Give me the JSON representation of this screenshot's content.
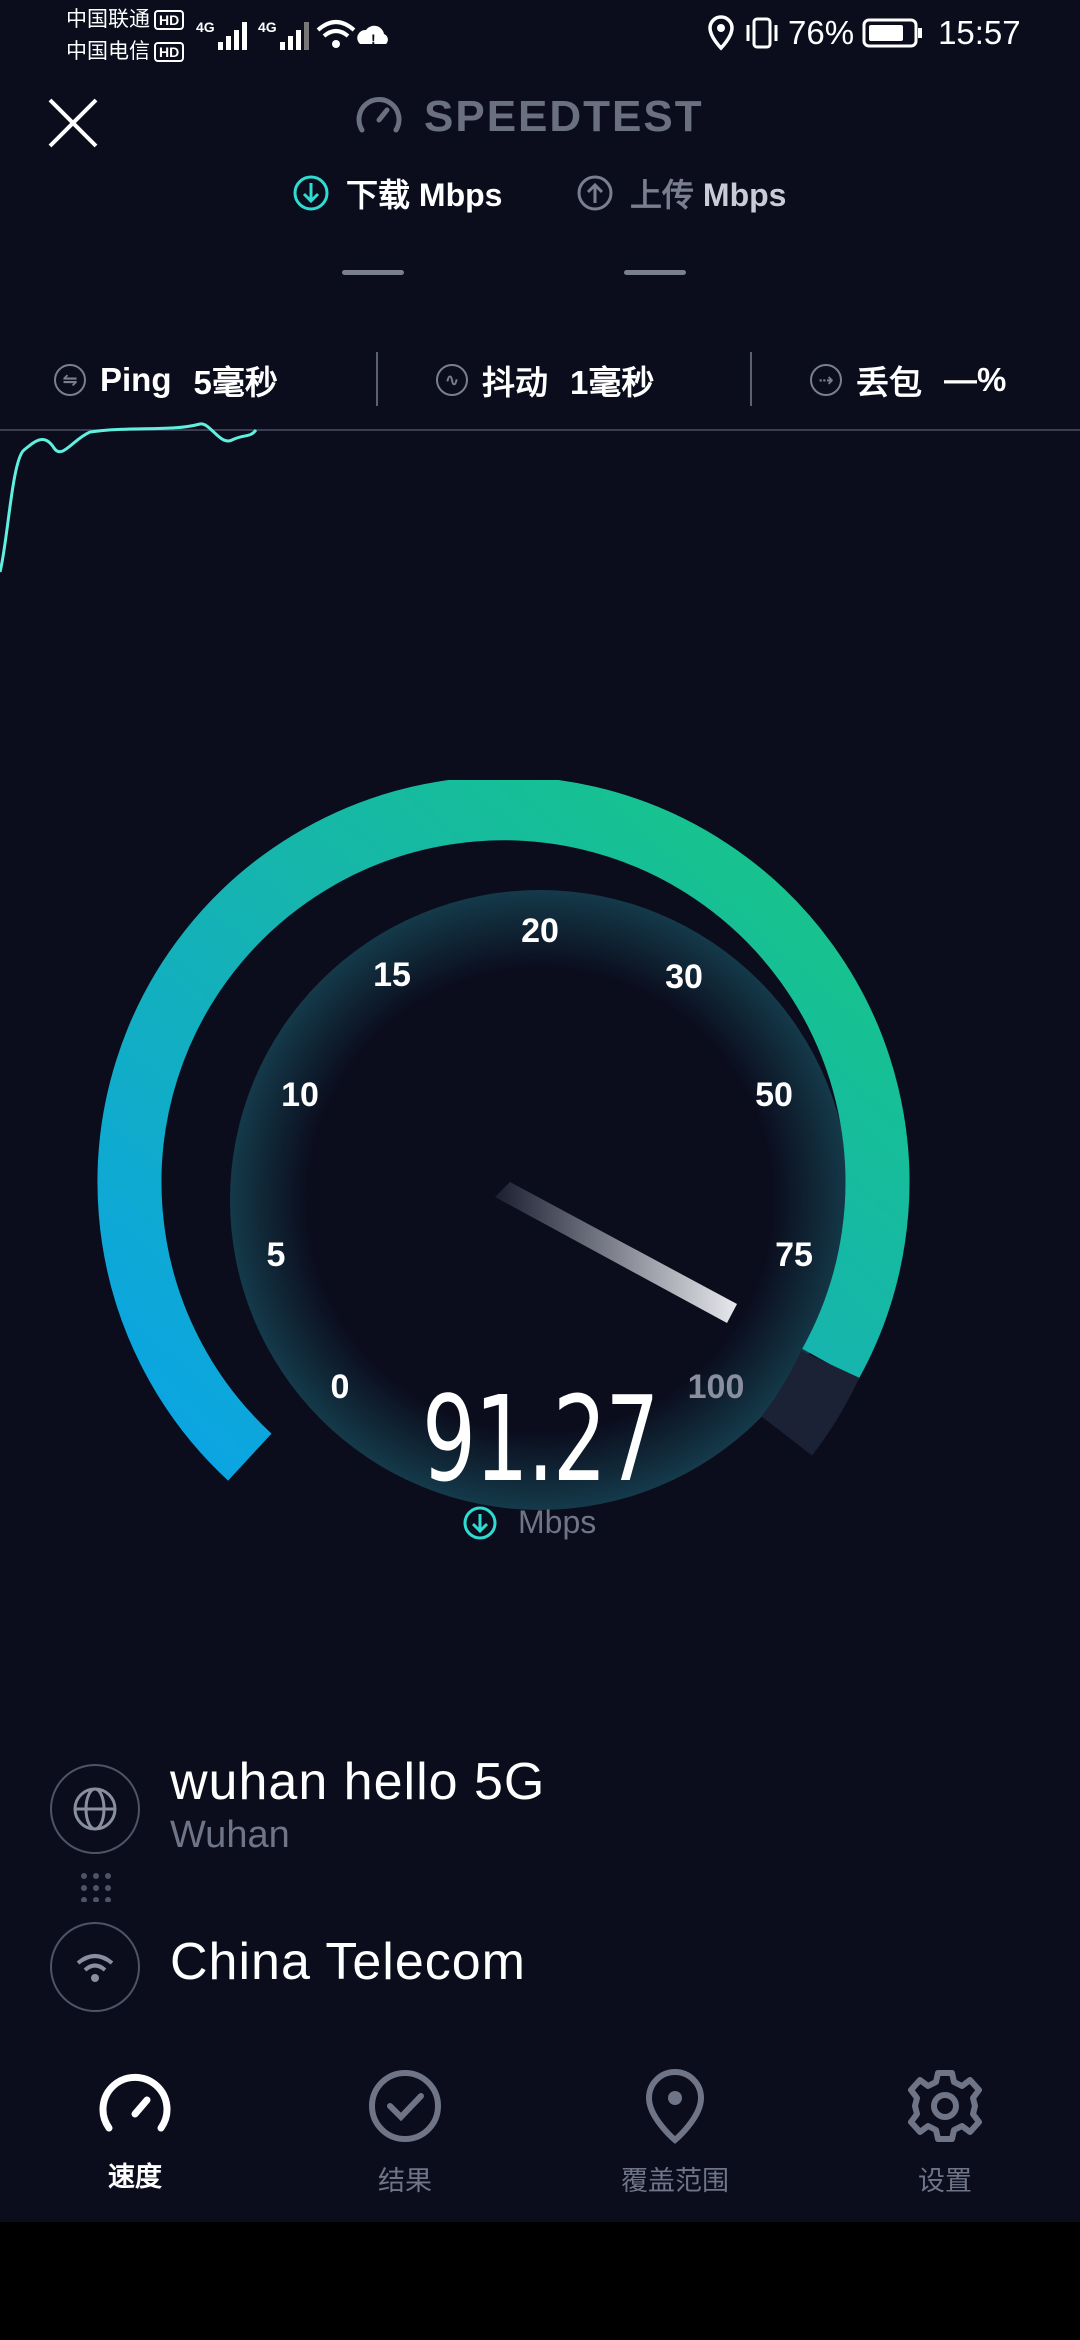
{
  "status_bar": {
    "carrier1": "中国联通",
    "carrier2": "中国电信",
    "hd": "HD",
    "network": "4G",
    "battery": "76%",
    "time": "15:57"
  },
  "header": {
    "title": "SPEEDTEST",
    "download_label": "下载",
    "upload_label": "上传",
    "unit": "Mbps"
  },
  "metrics": {
    "ping_label": "Ping",
    "ping_value": "5毫秒",
    "jitter_label": "抖动",
    "jitter_value": "1毫秒",
    "loss_label": "丢包",
    "loss_value": "—%"
  },
  "gauge": {
    "ticks": [
      "0",
      "5",
      "10",
      "15",
      "20",
      "30",
      "50",
      "75",
      "100"
    ],
    "speed": "91.27",
    "unit": "Mbps",
    "colors": {
      "start": "#0aa3e8",
      "mid": "#16b5ad",
      "end": "#17c882"
    }
  },
  "server": {
    "name": "wuhan hello 5G",
    "city": "Wuhan",
    "provider": "China Telecom"
  },
  "nav": {
    "speed": "速度",
    "results": "结果",
    "coverage": "覆盖范围",
    "settings": "设置"
  }
}
